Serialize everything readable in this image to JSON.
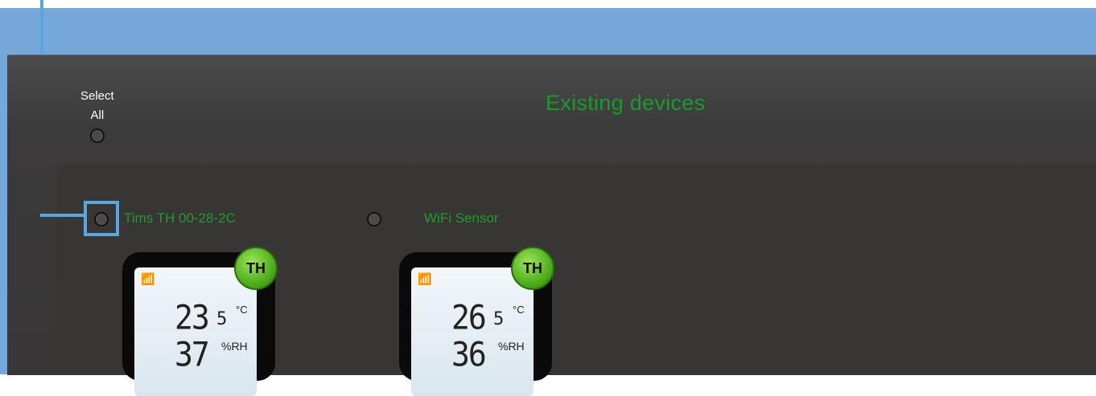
{
  "header": {
    "select_all_line1": "Select",
    "select_all_line2": "All",
    "title": "Existing devices"
  },
  "devices": [
    {
      "name": "Tims TH 00-28-2C",
      "badge": "TH",
      "temperature": "23",
      "temperature_decimal": "5",
      "temperature_unit": "°C",
      "humidity": "37",
      "humidity_unit": "%RH",
      "antenna_icon": "antenna-icon"
    },
    {
      "name": "WiFi Sensor",
      "badge": "TH",
      "temperature": "26",
      "temperature_decimal": "5",
      "temperature_unit": "°C",
      "humidity": "36",
      "humidity_unit": "%RH",
      "antenna_icon": "antenna-icon"
    }
  ],
  "colors": {
    "title_green": "#1a9a2a",
    "device_name_green": "#1b9e2c",
    "callout_blue": "#5aa6e0",
    "frame_blue": "#75a8d9"
  }
}
